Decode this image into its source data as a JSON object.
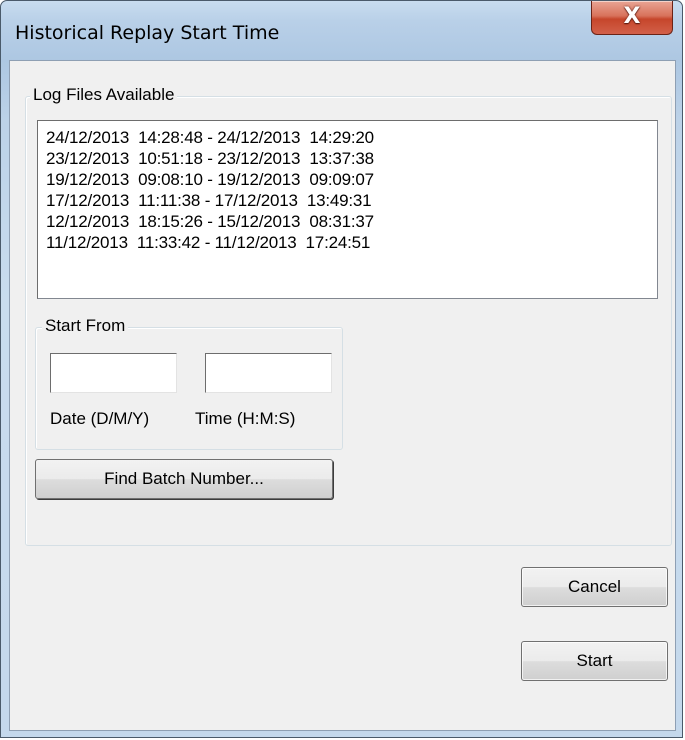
{
  "window": {
    "title": "Historical Replay Start Time",
    "close_label": "X"
  },
  "log_files": {
    "legend": "Log Files Available",
    "items": [
      "24/12/2013  14:28:48 - 24/12/2013  14:29:20",
      "23/12/2013  10:51:18 - 23/12/2013  13:37:38",
      "19/12/2013  09:08:10 - 19/12/2013  09:09:07",
      "17/12/2013  11:11:38 - 17/12/2013  13:49:31",
      "12/12/2013  18:15:26 - 15/12/2013  08:31:37",
      "11/12/2013  11:33:42 - 11/12/2013  17:24:51"
    ]
  },
  "start_from": {
    "legend": "Start From",
    "date_value": "",
    "time_value": "",
    "date_label": "Date (D/M/Y)",
    "time_label": "Time (H:M:S)"
  },
  "buttons": {
    "find_batch": "Find Batch Number...",
    "cancel": "Cancel",
    "start": "Start"
  },
  "colors": {
    "title_bar": "#b9d0e8",
    "close_button": "#c6462b",
    "client_bg": "#f0f0f0"
  },
  "icons": {
    "close": "close-icon"
  }
}
